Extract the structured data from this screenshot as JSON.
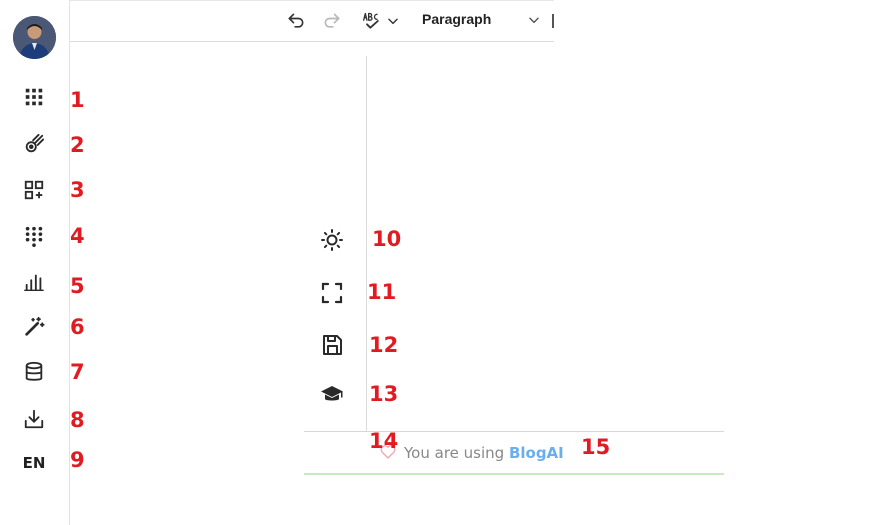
{
  "sidebar": {
    "avatar_alt": "",
    "items": [
      {
        "icon": "apps-grid-icon",
        "badge": "1"
      },
      {
        "icon": "meteor-icon",
        "badge": "2"
      },
      {
        "icon": "add-widget-icon",
        "badge": "3"
      },
      {
        "icon": "dialpad-icon",
        "badge": "4"
      },
      {
        "icon": "bar-chart-icon",
        "badge": "5"
      },
      {
        "icon": "magic-wand-icon",
        "badge": "6"
      },
      {
        "icon": "database-icon",
        "badge": "7"
      },
      {
        "icon": "download-icon",
        "badge": "8"
      },
      {
        "label": "EN",
        "badge": "9"
      }
    ]
  },
  "toolbar": {
    "undo_icon": "undo-icon",
    "redo_icon": "redo-icon",
    "spellcheck_icon": "spellcheck-icon",
    "block_format": "Paragraph"
  },
  "floating_menu": {
    "items": [
      {
        "icon": "sun-icon",
        "badge": "10"
      },
      {
        "icon": "fullscreen-icon",
        "badge": "11"
      },
      {
        "icon": "save-icon",
        "badge": "12"
      },
      {
        "icon": "graduation-cap-icon",
        "badge": "13"
      },
      {
        "icon": "logout-icon",
        "badge": "14"
      }
    ]
  },
  "status": {
    "prefix": "You are using ",
    "brand": "BlogAI",
    "badge": "15"
  },
  "colors": {
    "badge_red": "#e11b22",
    "brand_blue": "#6aaef0"
  }
}
